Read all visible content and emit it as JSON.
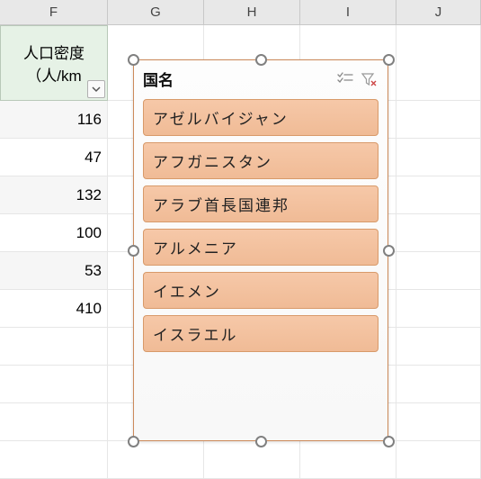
{
  "columns": [
    "F",
    "G",
    "H",
    "I",
    "J"
  ],
  "header": {
    "line1": "人口密度",
    "line2": "（人/km"
  },
  "rows": [
    {
      "value": "116",
      "shaded": true
    },
    {
      "value": "47",
      "shaded": false
    },
    {
      "value": "132",
      "shaded": true
    },
    {
      "value": "100",
      "shaded": false
    },
    {
      "value": "53",
      "shaded": true
    },
    {
      "value": "410",
      "shaded": false
    }
  ],
  "slicer": {
    "title": "国名",
    "multiselect_icon": "multi-select-icon",
    "clear_icon": "clear-filter-icon",
    "items": [
      "アゼルバイジャン",
      "アフガニスタン",
      "アラブ首長国連邦",
      "アルメニア",
      "イエメン",
      "イスラエル"
    ]
  }
}
